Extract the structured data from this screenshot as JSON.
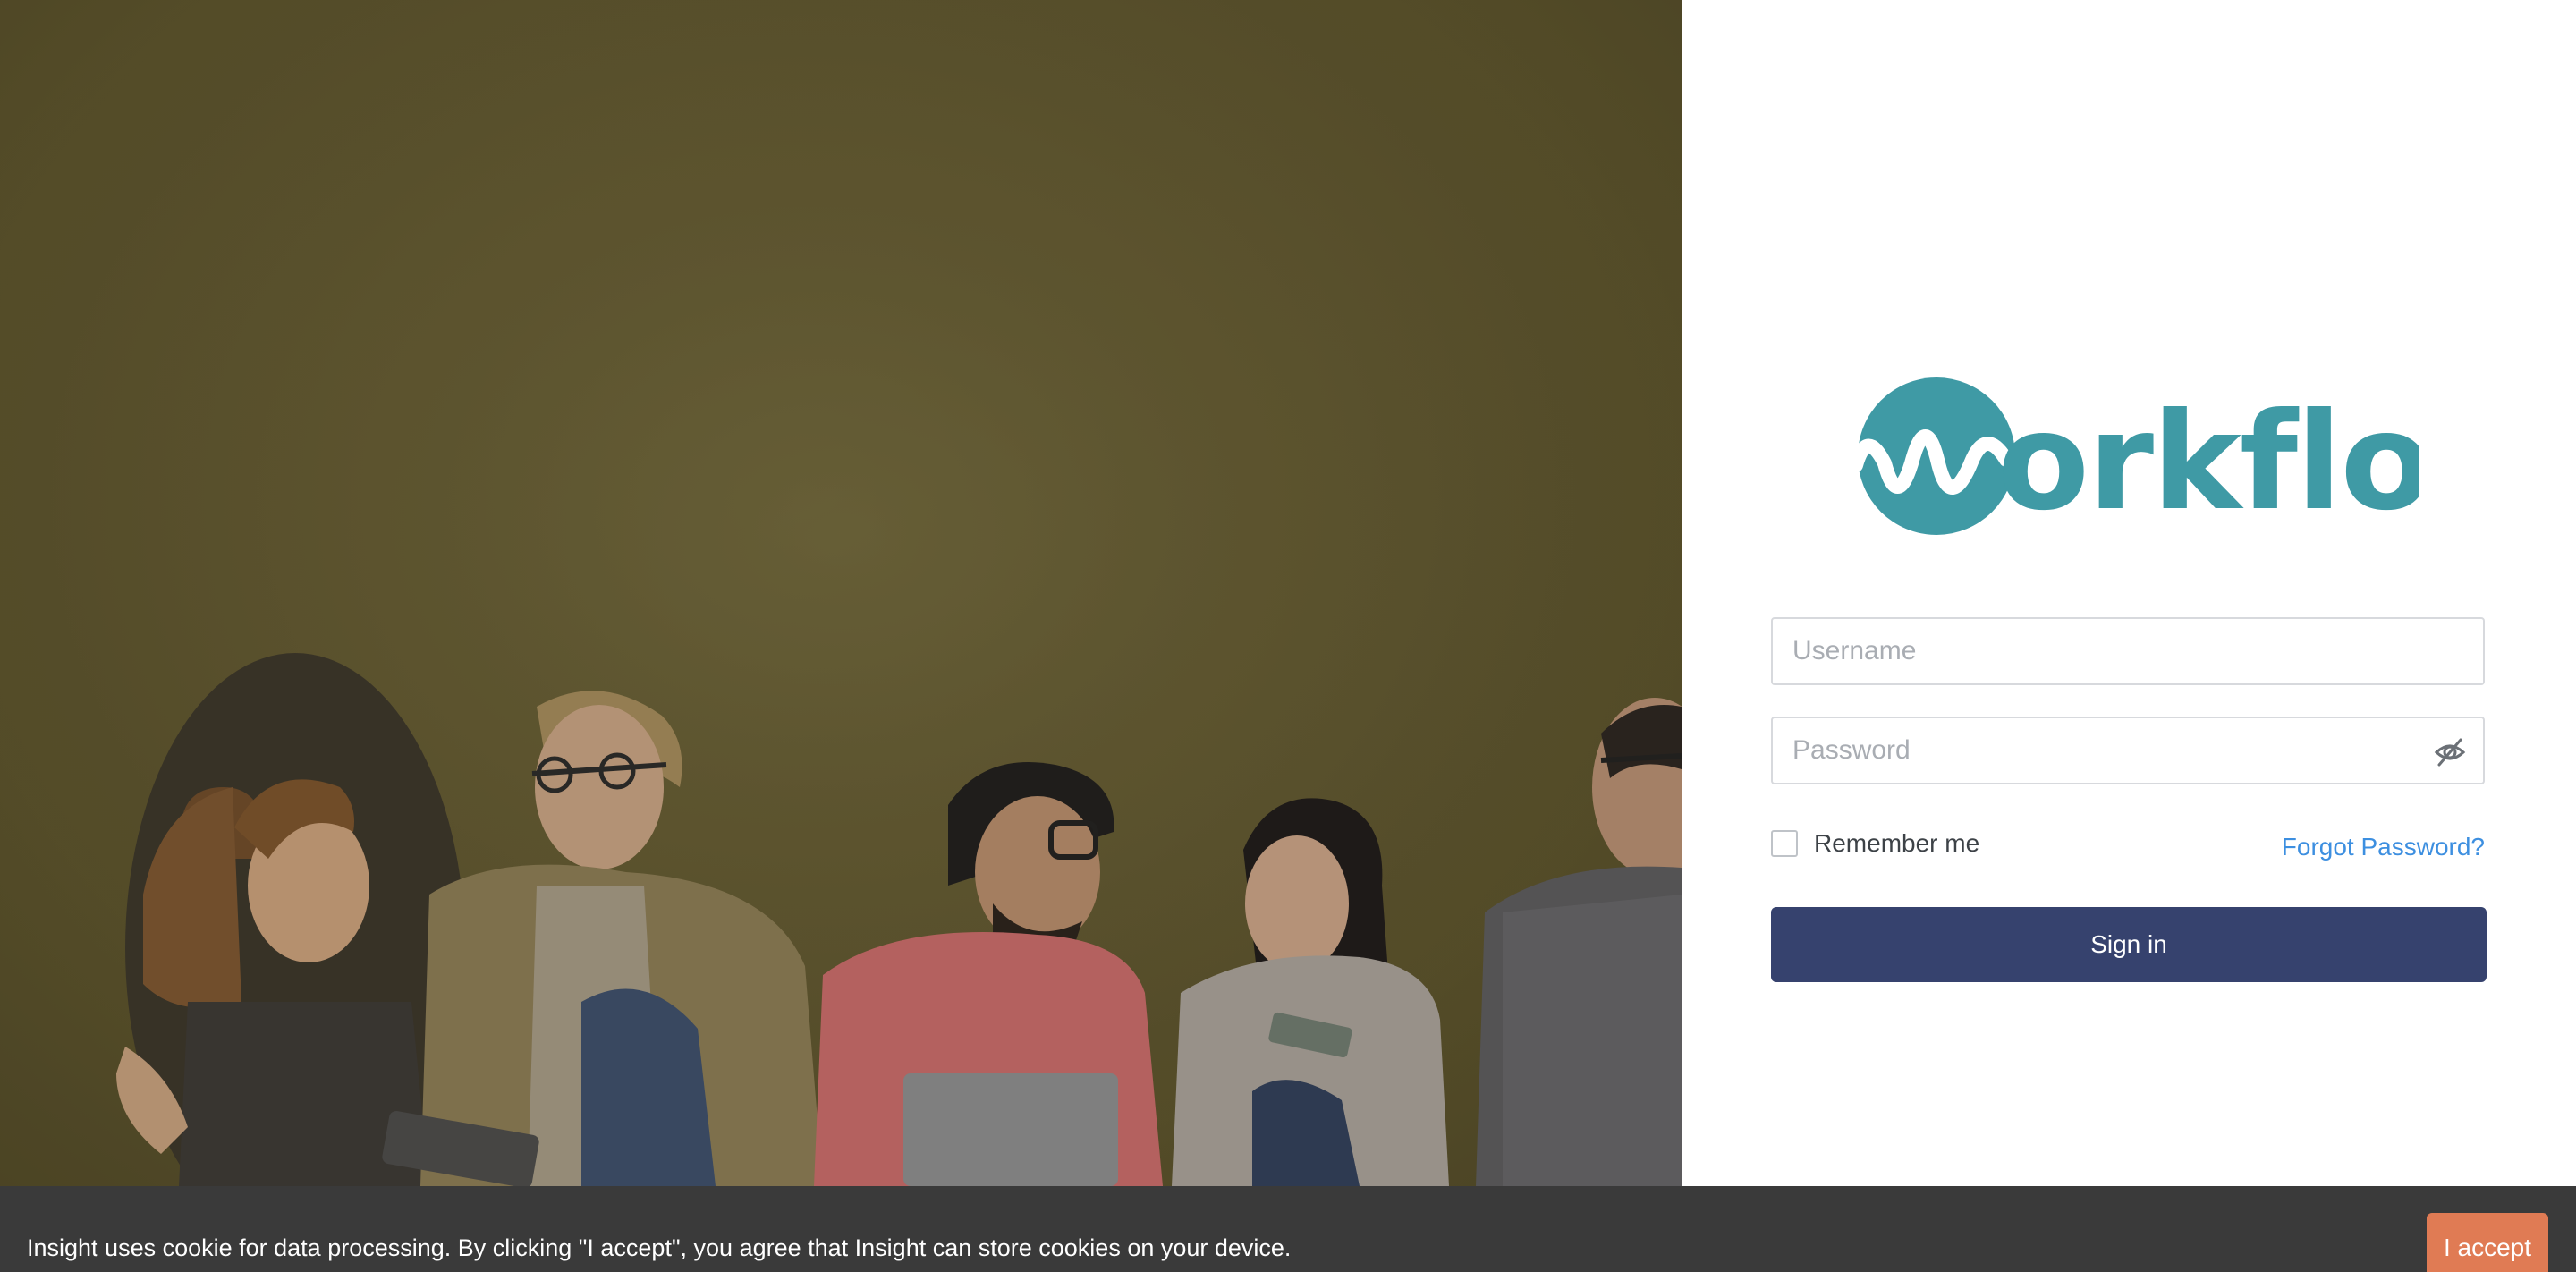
{
  "app": {
    "brand": "workflow"
  },
  "login": {
    "username_placeholder": "Username",
    "password_placeholder": "Password",
    "remember_label": "Remember me",
    "forgot_label": "Forgot Password?",
    "signin_label": "Sign in",
    "remember_checked": false
  },
  "cookie": {
    "message": "Insight uses cookie for data processing. By clicking \"I accept\", you agree that Insight can store cookies on your device.",
    "accept_label": "I accept"
  },
  "icons": {
    "password_toggle": "eye-slash-icon"
  },
  "colors": {
    "brand_teal": "#3f9aa5",
    "signin_button": "#36426e",
    "link": "#3d8fe0",
    "cookie_bar": "#3a3a3a",
    "accept_button": "#e07b54",
    "hero_tone": "#5e5630"
  }
}
